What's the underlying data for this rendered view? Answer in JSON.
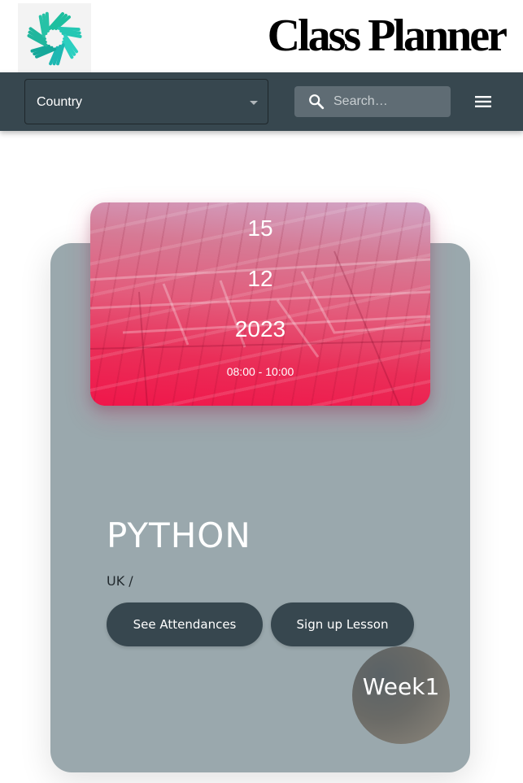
{
  "header": {
    "title": "Class Planner",
    "logo_icon": "teal-snowflake-logo"
  },
  "toolbar": {
    "country_select": {
      "label": "Country"
    },
    "search": {
      "placeholder": "Search…",
      "value": ""
    },
    "menu_icon": "hamburger-menu-icon"
  },
  "card": {
    "date": {
      "day": "15",
      "month": "12",
      "year": "2023",
      "time": "08:00 - 10:00"
    },
    "title": "PYTHON",
    "location": "UK /",
    "attendances_button": "See Attendances",
    "signup_button": "Sign up Lesson",
    "week": "Week1"
  },
  "colors": {
    "toolbar": "#37474f",
    "card": "#9aa8ad",
    "date_panel": "#f0164a",
    "button": "#37474f"
  }
}
